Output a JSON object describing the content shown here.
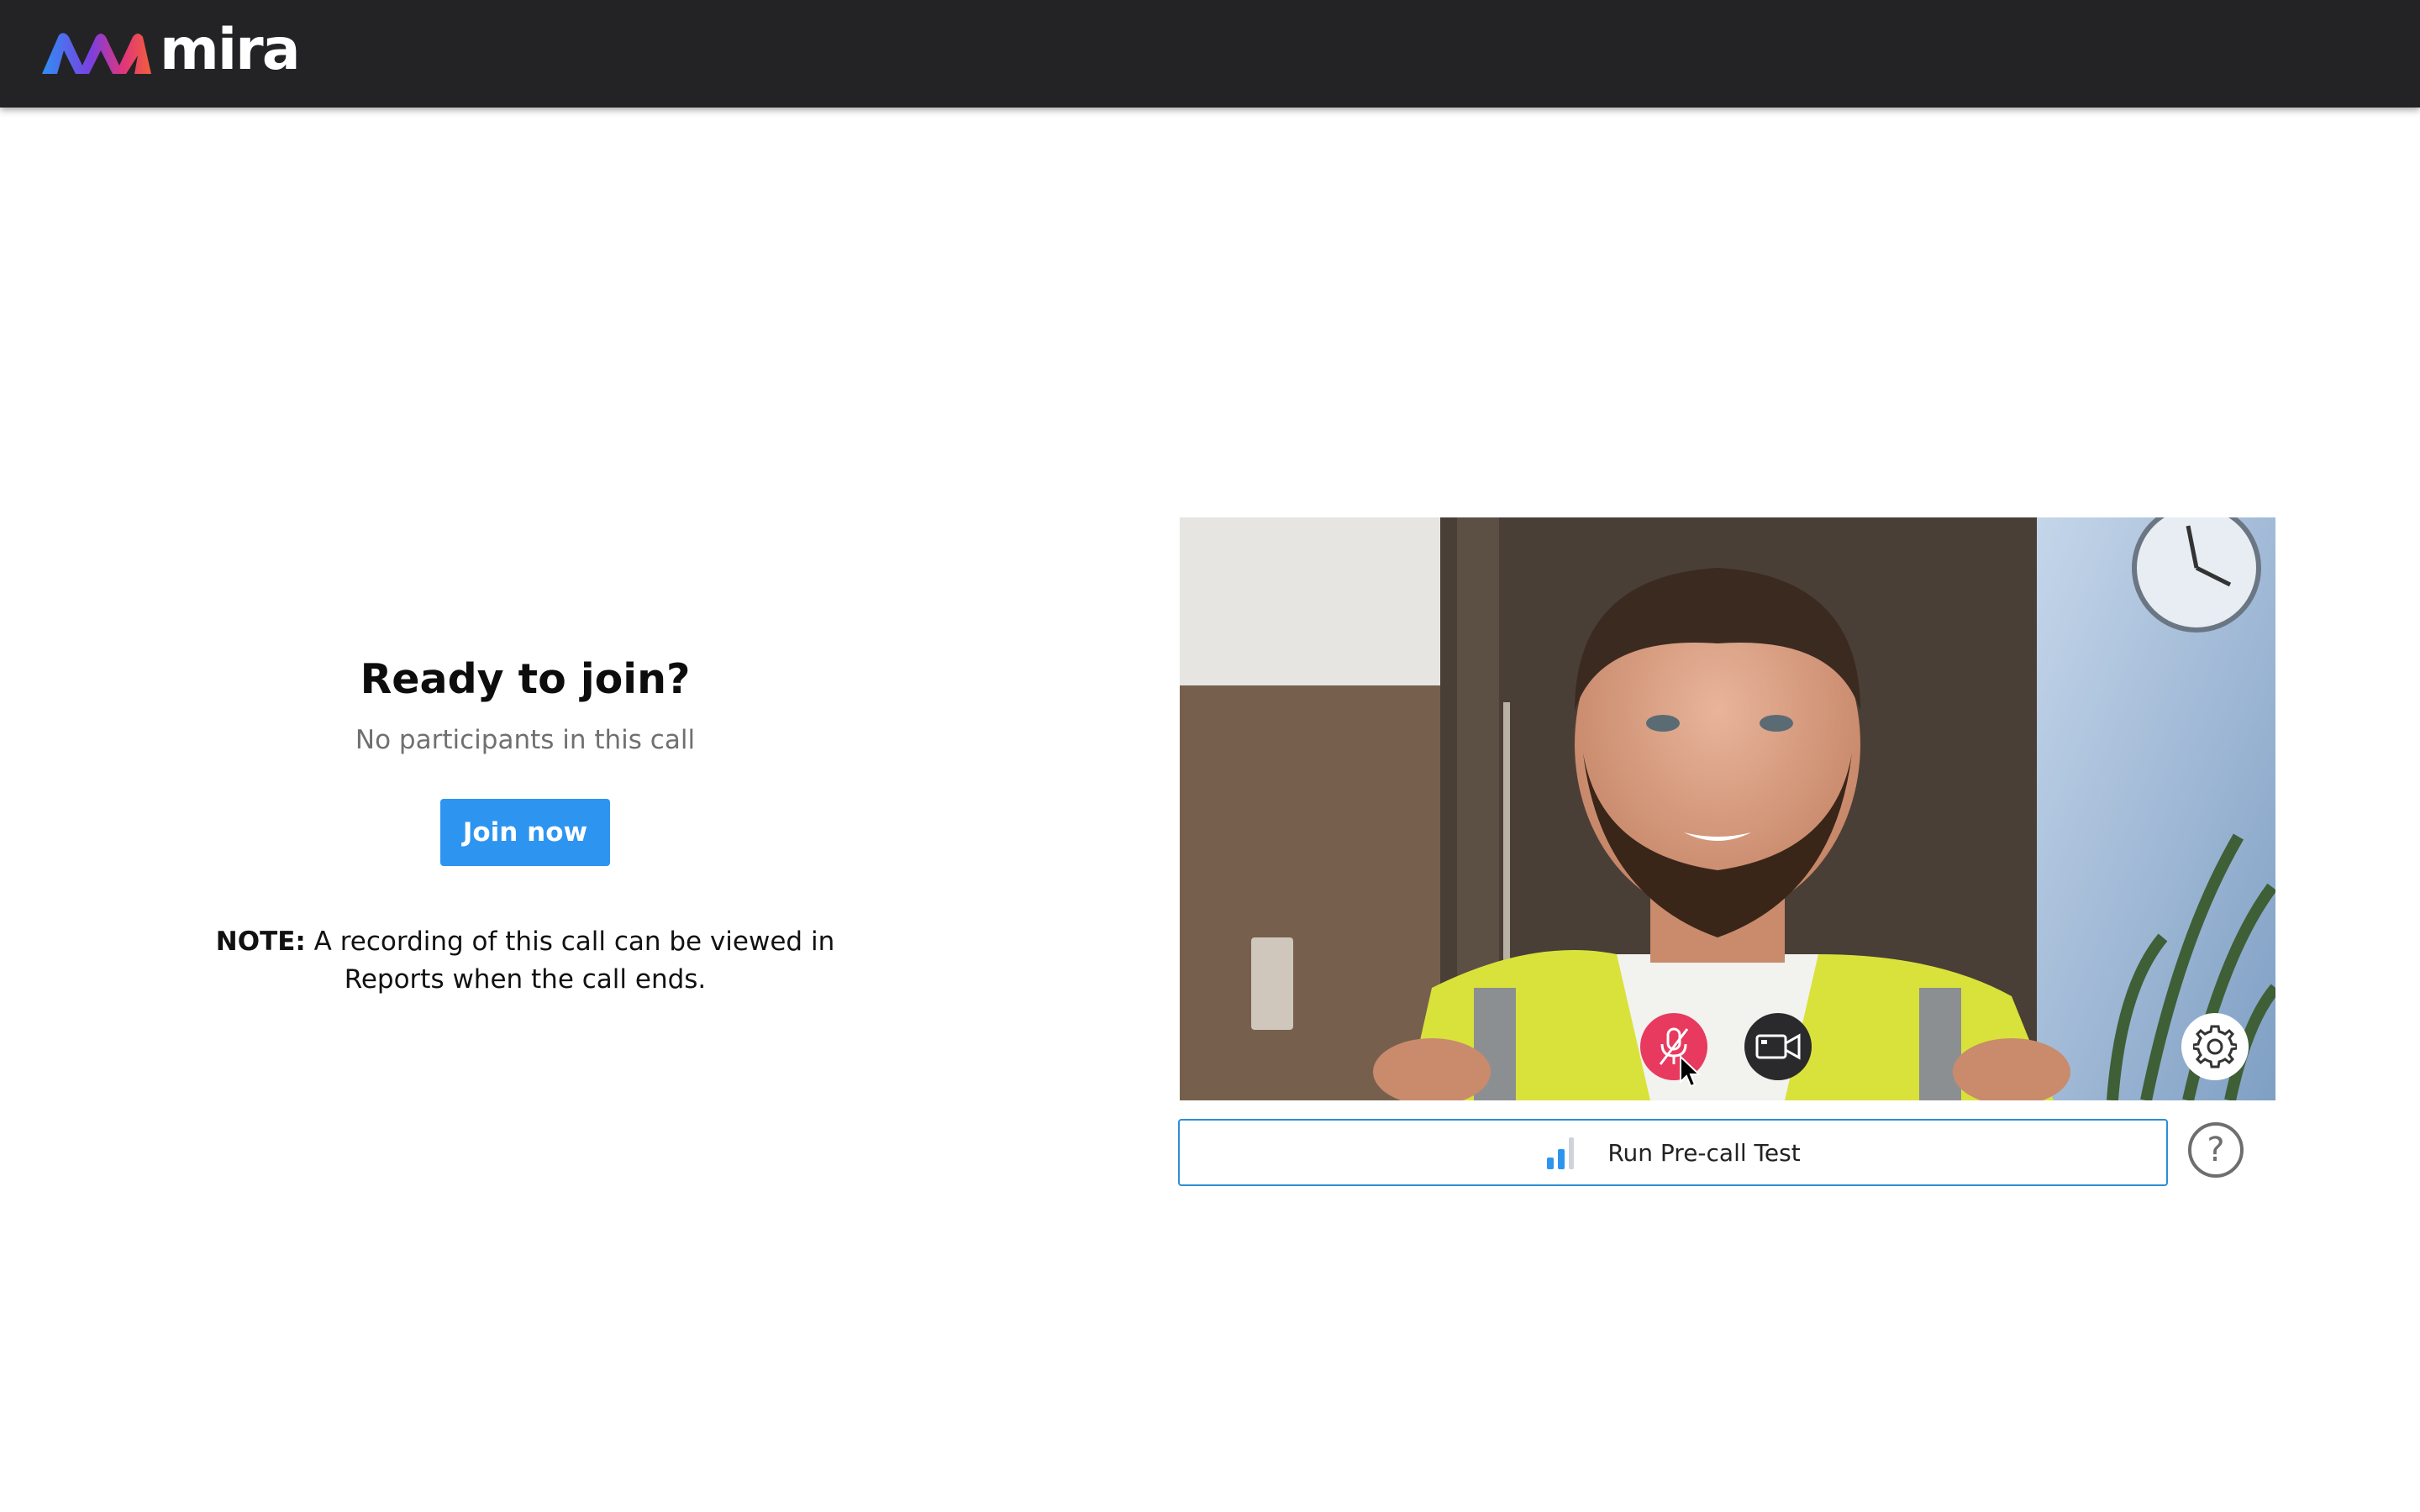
{
  "header": {
    "brand": "mira",
    "logo_icon": "mira-wave-logo"
  },
  "join": {
    "title": "Ready to join?",
    "subtitle": "No participants in this call",
    "join_button": "Join now",
    "note_label": "NOTE:",
    "note_text": " A recording of this call can be viewed in Reports when the call ends."
  },
  "video": {
    "mic_state": "muted",
    "icons": {
      "mic": "mic-off-icon",
      "camera": "camera-icon",
      "settings": "gear-icon"
    }
  },
  "precall": {
    "label": "Run Pre-call Test",
    "icon": "signal-bars-icon"
  },
  "help": {
    "label": "?"
  },
  "colors": {
    "header_bg": "#232325",
    "join_button": "#2d95f0",
    "mic_muted": "#e8395f",
    "precall_border": "#2c8fd6"
  }
}
